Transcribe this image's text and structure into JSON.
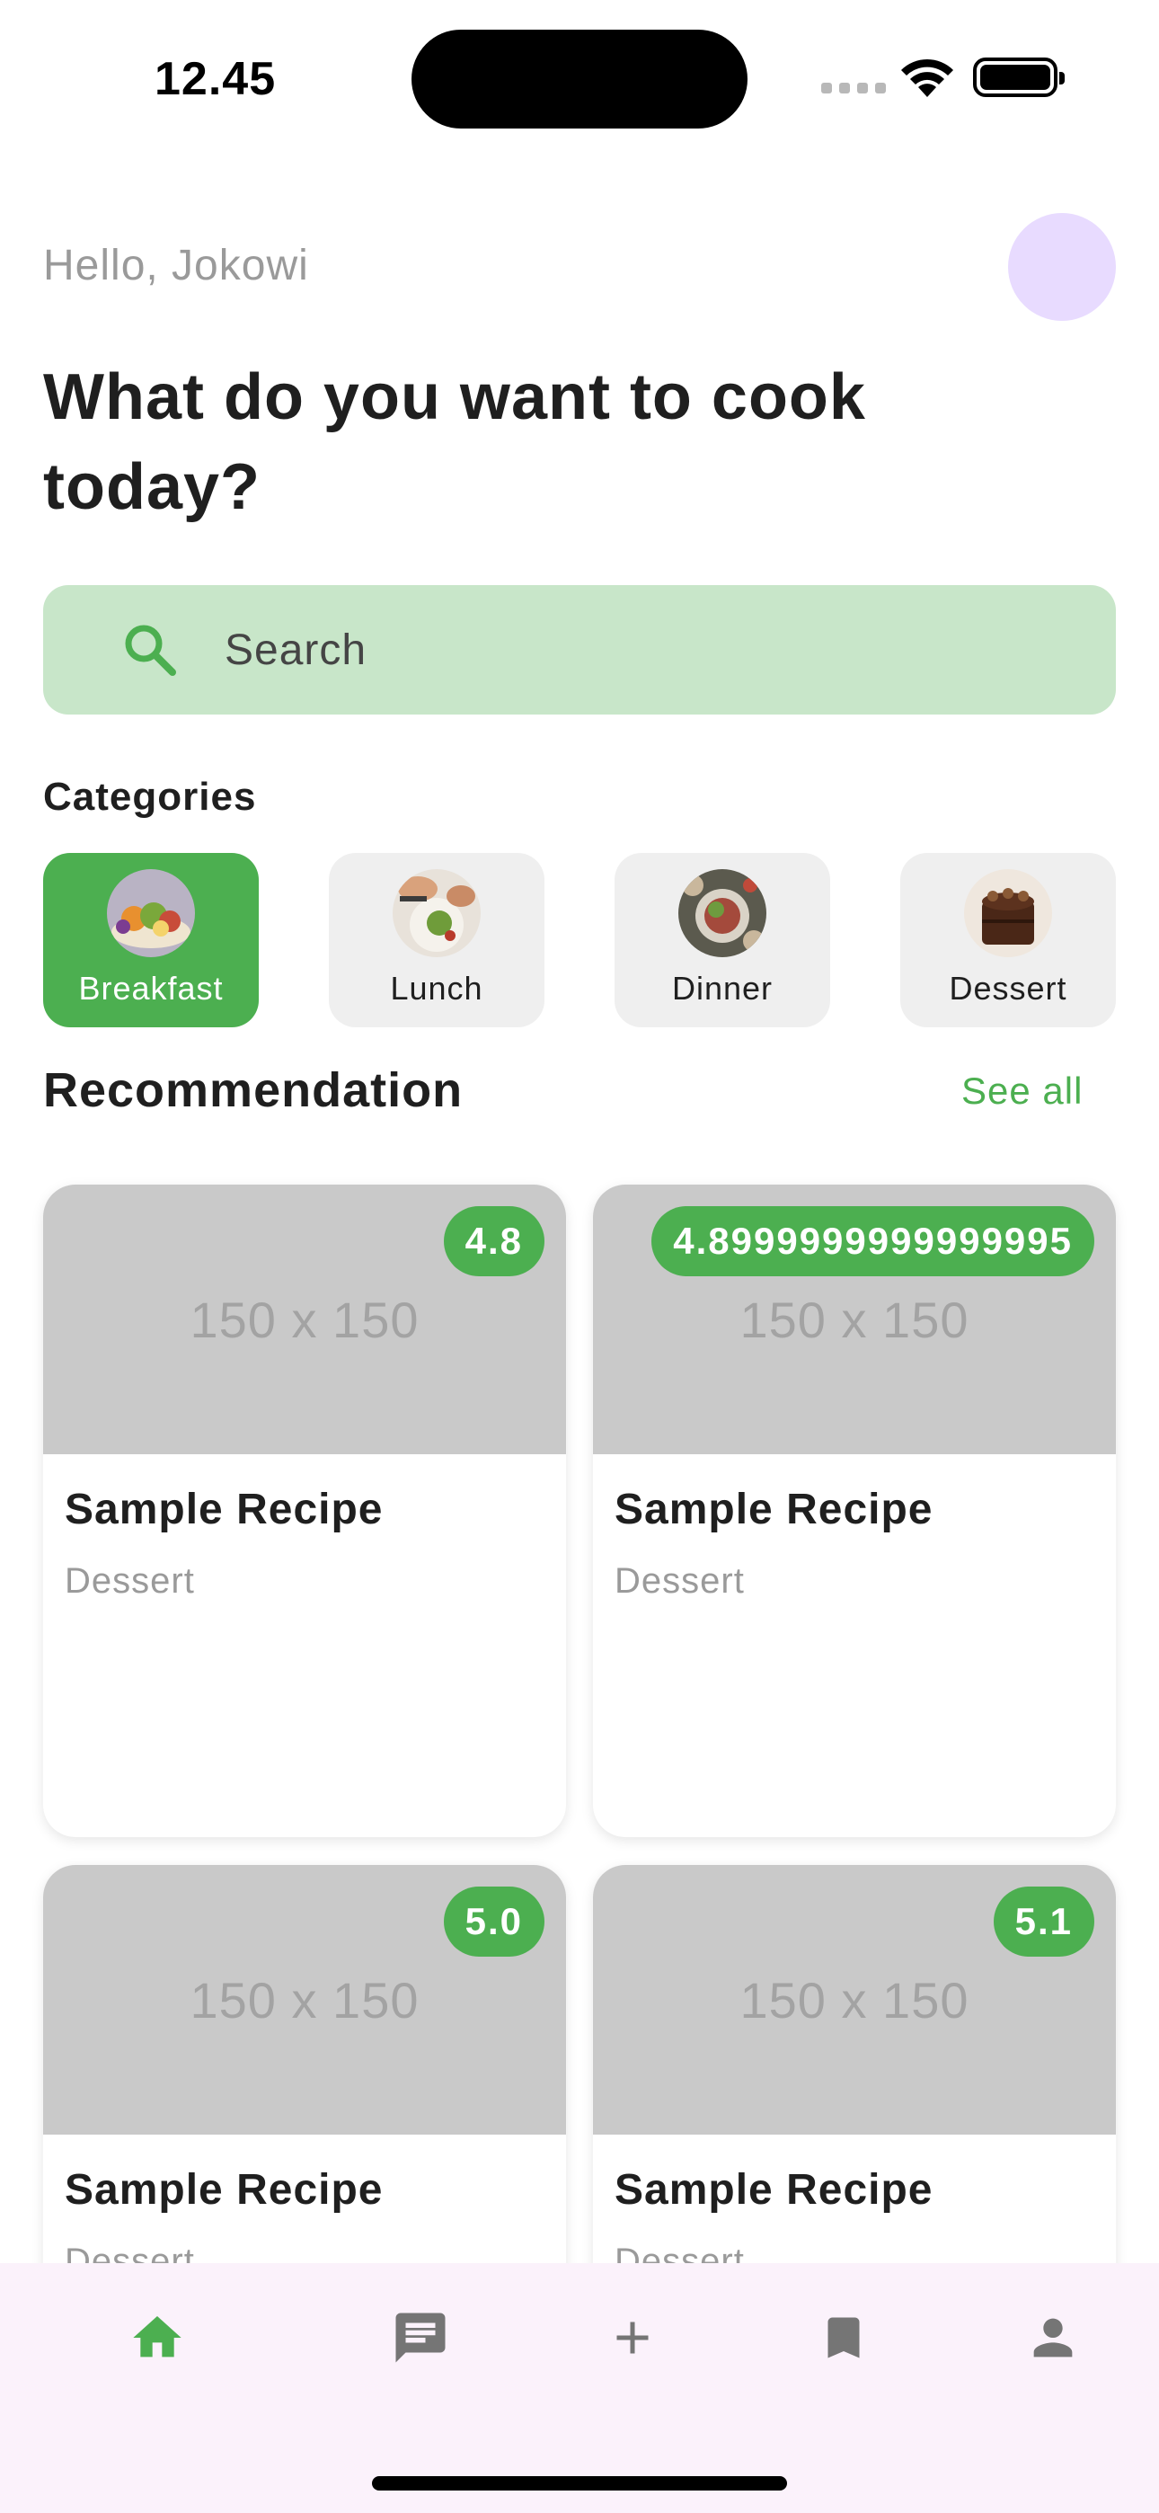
{
  "status_bar": {
    "time": "12.45"
  },
  "header": {
    "greeting": "Hello, Jokowi",
    "headline": "What do you want to cook today?"
  },
  "search": {
    "placeholder": "Search",
    "icon": "search-icon"
  },
  "categories": {
    "title": "Categories",
    "items": [
      {
        "label": "Breakfast",
        "selected": true
      },
      {
        "label": "Lunch",
        "selected": false
      },
      {
        "label": "Dinner",
        "selected": false
      },
      {
        "label": "Dessert",
        "selected": false
      }
    ]
  },
  "recommendation": {
    "title": "Recommendation",
    "see_all": "See all",
    "cards": [
      {
        "image_placeholder": "150 x 150",
        "rating": "4.8",
        "title": "Sample Recipe",
        "category": "Dessert"
      },
      {
        "image_placeholder": "150 x 150",
        "rating": "4.8999999999999995",
        "title": "Sample Recipe",
        "category": "Dessert"
      },
      {
        "image_placeholder": "150 x 150",
        "rating": "5.0",
        "title": "Sample Recipe",
        "category": "Dessert"
      },
      {
        "image_placeholder": "150 x 150",
        "rating": "5.1",
        "title": "Sample Recipe",
        "category": "Dessert"
      }
    ]
  },
  "bottom_nav": {
    "items": [
      {
        "icon": "home-icon",
        "active": true
      },
      {
        "icon": "chat-icon",
        "active": false
      },
      {
        "icon": "add-icon",
        "active": false
      },
      {
        "icon": "bookmark-icon",
        "active": false
      },
      {
        "icon": "profile-icon",
        "active": false
      }
    ]
  },
  "colors": {
    "accent": "#4caf50",
    "search_bg": "#c8e6c9",
    "avatar_bg": "#e8dbff",
    "nav_bg": "#fbf2fb",
    "inactive_icon": "#757575"
  }
}
